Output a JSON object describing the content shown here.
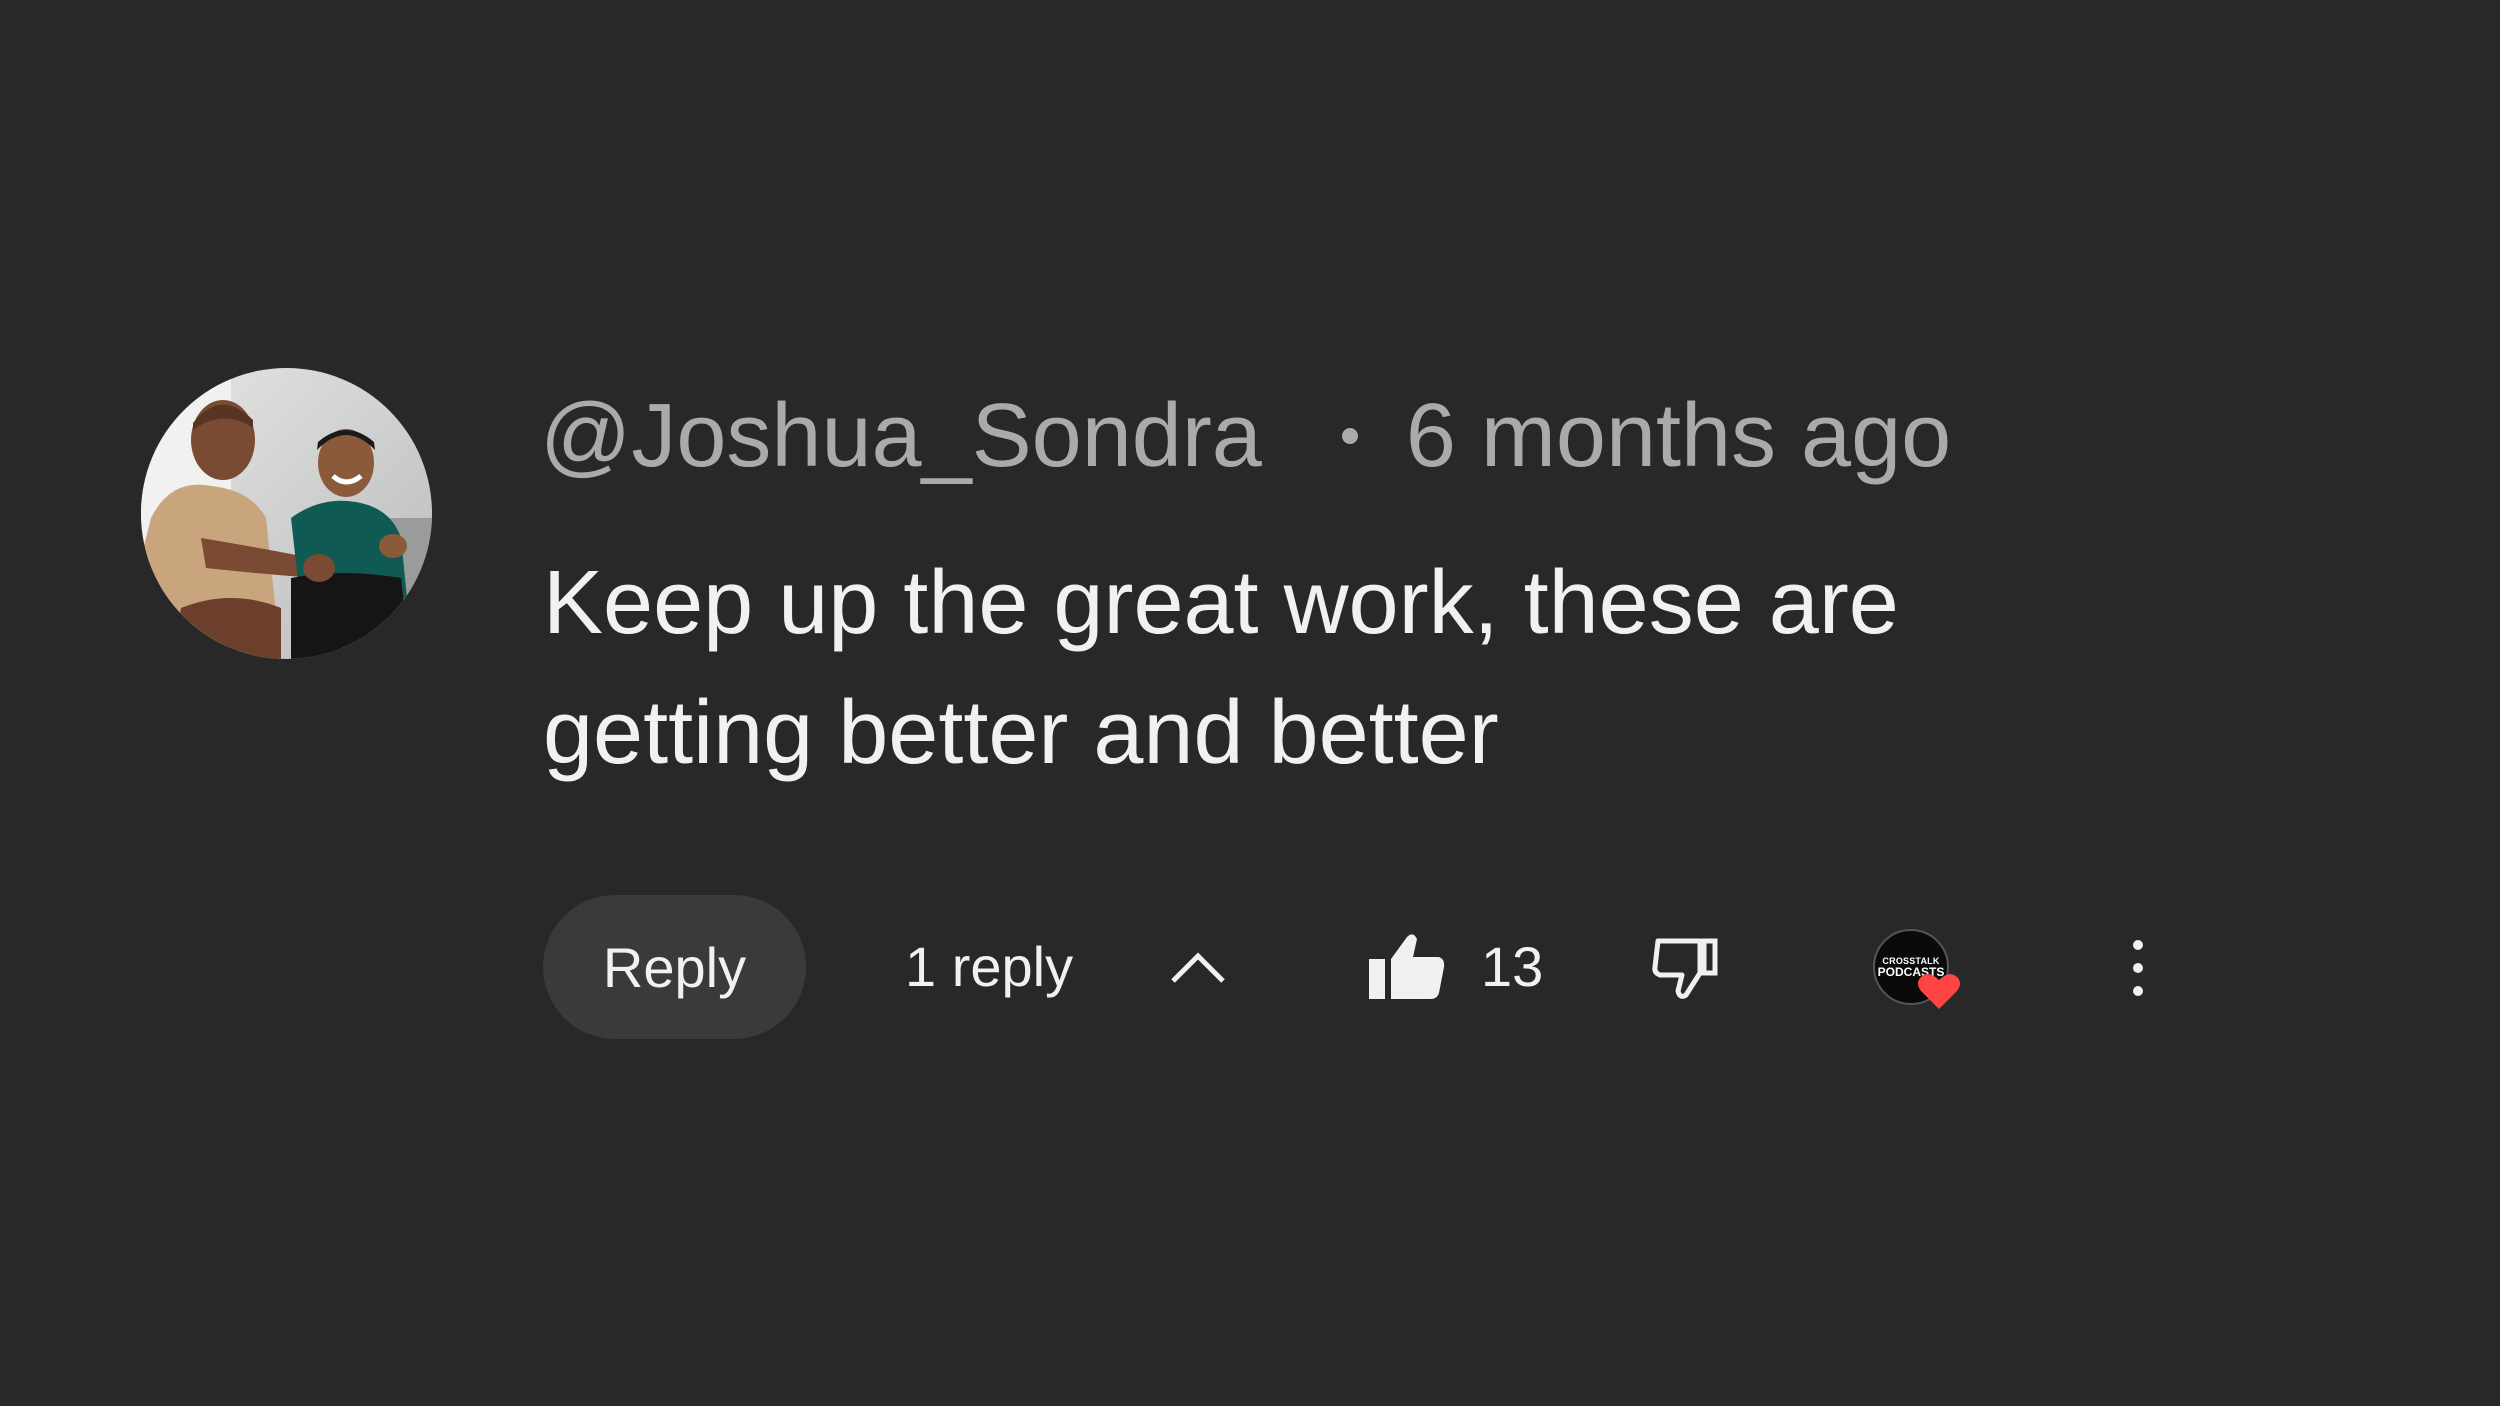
{
  "comment": {
    "author": "@Joshua_Sondra",
    "timestamp": "6 months ago",
    "text_lines": [
      "Keep up the great work, these are",
      "getting better and better"
    ]
  },
  "actions": {
    "reply_label": "Reply",
    "reply_count": "1 reply",
    "like_count": "13",
    "creator_badge": {
      "line1": "CROSSTALK",
      "line2": "PODCASTS"
    }
  },
  "icons": {
    "avatar": "user-avatar-photo",
    "collapse": "chevron-up-icon",
    "like": "thumbs-up-icon",
    "dislike": "thumbs-down-icon",
    "heart": "heart-icon",
    "more": "more-vertical-icon"
  },
  "colors": {
    "background": "#282828",
    "meta_text": "#aaaaaa",
    "body_text": "#f1f1f1",
    "reply_button_bg": "#3a3a3a",
    "heart": "#ff4444"
  }
}
